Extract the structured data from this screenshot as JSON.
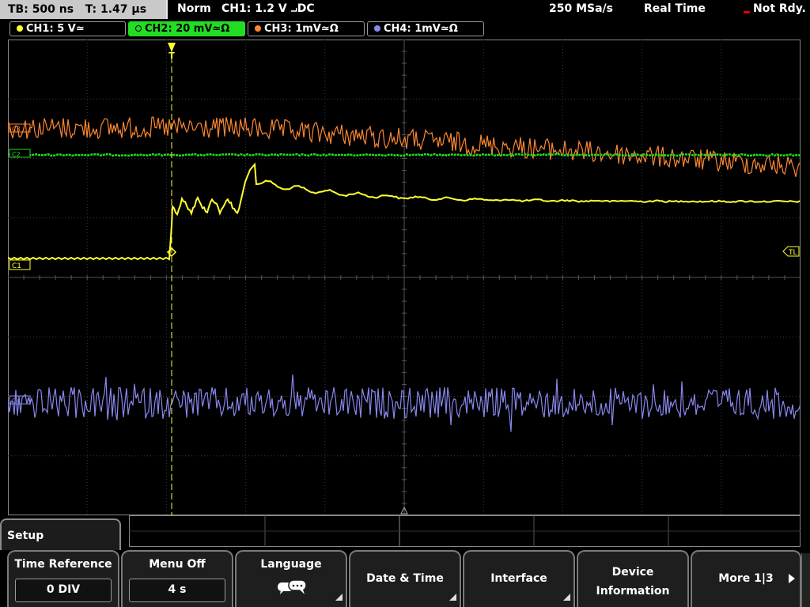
{
  "status": {
    "timebase": "TB: 500 ns",
    "trigger_time": "T: 1.47 µs",
    "mode": "Norm",
    "trigger_setting": "CH1: 1.2 V ⨼DC",
    "sample_rate": "250 MSa/s",
    "acq_mode": "Real Time",
    "state": "Not Rdy."
  },
  "channels": [
    {
      "label": "CH1: 5 V≃",
      "color": "#ffff33",
      "marker": "C1"
    },
    {
      "label": "CH2: 20 mV≃Ω",
      "color": "#22dd22",
      "marker": "C2"
    },
    {
      "label": "CH3: 1mV≃Ω",
      "color": "#ff8833",
      "marker": "C3"
    },
    {
      "label": "CH4: 1mV≃Ω",
      "color": "#8888ee",
      "marker": "C4"
    }
  ],
  "trigger_level_marker": "TL",
  "trigger_pos_marker": "T",
  "menu": {
    "title": "Setup",
    "softkeys": [
      {
        "label": "Time Reference",
        "value": "0 DIV"
      },
      {
        "label": "Menu Off",
        "value": "4 s"
      },
      {
        "label": "Language",
        "icon": "speech-bubbles-icon"
      },
      {
        "label": "Date & Time"
      },
      {
        "label": "Interface"
      },
      {
        "label": "Device",
        "label2": "Information"
      },
      {
        "label": "More 1|3"
      }
    ]
  },
  "colors": {
    "grid": "#4a4a4a",
    "ch1": "#ffff33",
    "ch2": "#22dd22",
    "ch3": "#ff8833",
    "ch4": "#8888ee"
  }
}
